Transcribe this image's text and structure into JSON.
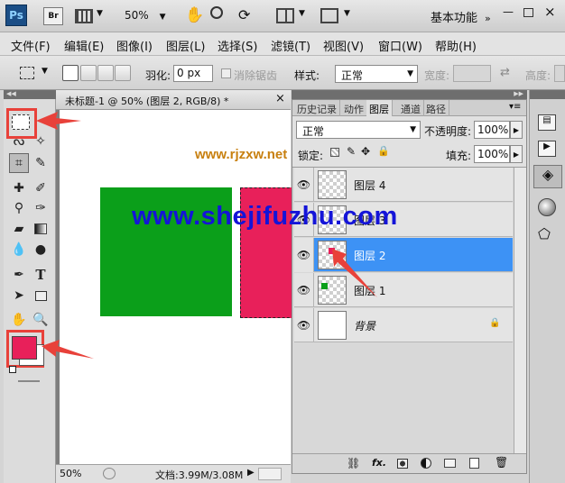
{
  "app": {
    "logo_text": "Ps",
    "bridge_label": "Br",
    "zoom_value": "50%",
    "workspace_label": "基本功能"
  },
  "menu": [
    "文件(F)",
    "编辑(E)",
    "图像(I)",
    "图层(L)",
    "选择(S)",
    "滤镜(T)",
    "视图(V)",
    "窗口(W)",
    "帮助(H)"
  ],
  "options": {
    "feather_label": "羽化:",
    "feather_value": "0 px",
    "antialias_label": "消除锯齿",
    "style_label": "样式:",
    "style_value": "正常",
    "width_label": "宽度:",
    "height_label": "高度:"
  },
  "document": {
    "tab_title": "未标题-1 @ 50% (图层 2, RGB/8) *",
    "close_glyph": "×",
    "zoom": "50%",
    "doc_info": "文档:3.99M/3.08M"
  },
  "panel": {
    "tabs": [
      "历史记录",
      "动作",
      "图层",
      "通道",
      "路径"
    ],
    "active_tab": "图层",
    "blend_mode": "正常",
    "opacity_label": "不透明度:",
    "opacity_value": "100%",
    "lock_label": "锁定:",
    "fill_label": "填充:",
    "fill_value": "100%",
    "layers": [
      {
        "name": "图层 4",
        "selected": false
      },
      {
        "name": "图层 3",
        "selected": false
      },
      {
        "name": "图层 2",
        "selected": true
      },
      {
        "name": "图层 1",
        "selected": false
      },
      {
        "name": "背景",
        "selected": false,
        "locked": true
      }
    ]
  },
  "watermarks": {
    "small": "www.rjzxw.net",
    "large": "www.shejifuzhu.com"
  },
  "colors": {
    "green_rect": "#0b9f1a",
    "red_rect": "#e8205a",
    "foreground": "#e8205a",
    "highlight_red": "#e8413a",
    "selected_layer": "#3d92f5",
    "watermark_blue": "#1414d8",
    "watermark_orange": "#c88010"
  }
}
